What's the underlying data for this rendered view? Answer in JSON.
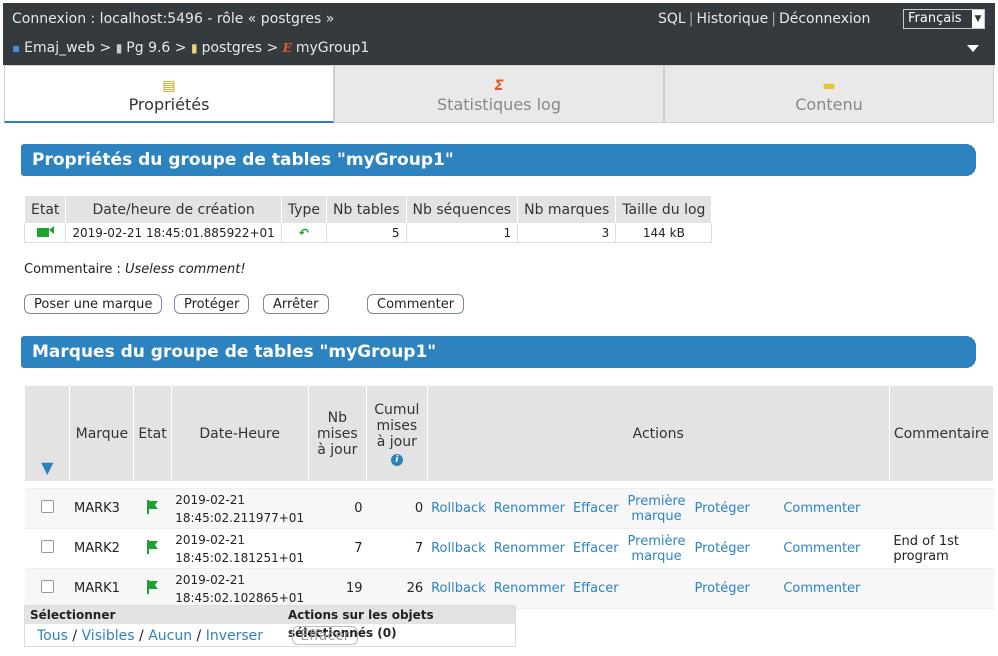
{
  "header": {
    "connexion": "Connexion : localhost:5496 - rôle « postgres »",
    "links": [
      "SQL",
      "Historique",
      "Déconnexion"
    ],
    "language": "Français"
  },
  "breadcrumb": [
    {
      "icon": "emaj-icon",
      "label": "Emaj_web"
    },
    {
      "icon": "server-icon",
      "label": "Pg 9.6"
    },
    {
      "icon": "database-icon",
      "label": "postgres"
    },
    {
      "icon": "group-icon",
      "label": "myGroup1"
    }
  ],
  "tabs": [
    {
      "label": "Propriétés",
      "icon": "properties-icon",
      "active": true
    },
    {
      "label": "Statistiques log",
      "icon": "sigma-icon",
      "active": false
    },
    {
      "label": "Contenu",
      "icon": "folder-icon",
      "active": false
    }
  ],
  "properties": {
    "title": "Propriétés du groupe de tables \"myGroup1\"",
    "headers": [
      "Etat",
      "Date/heure de création",
      "Type",
      "Nb tables",
      "Nb séquences",
      "Nb marques",
      "Taille du log"
    ],
    "row": {
      "created": "2019-02-21 18:45:01.885922+01",
      "nb_tables": "5",
      "nb_sequences": "1",
      "nb_marques": "3",
      "log_size": "144 kB"
    },
    "comment_label": "Commentaire : ",
    "comment_value": "Useless comment!",
    "buttons": [
      "Poser une marque",
      "Protéger",
      "Arrêter",
      "Commenter"
    ]
  },
  "marks": {
    "title": "Marques du groupe de tables \"myGroup1\"",
    "headers": {
      "marque": "Marque",
      "etat": "Etat",
      "date": "Date-Heure",
      "nb": "Nb mises à jour",
      "cumul": "Cumul mises à jour",
      "actions": "Actions",
      "commentaire": "Commentaire"
    },
    "rows": [
      {
        "mark": "MARK3",
        "date1": "2019-02-21",
        "date2": "18:45:02.211977+01",
        "nb": "0",
        "cumul": "0",
        "a1": "Rollback",
        "a2": "Renommer",
        "a3": "Effacer",
        "a4": "Première marque",
        "a5": "Protéger",
        "a6": "Commenter",
        "comment": ""
      },
      {
        "mark": "MARK2",
        "date1": "2019-02-21",
        "date2": "18:45:02.181251+01",
        "nb": "7",
        "cumul": "7",
        "a1": "Rollback",
        "a2": "Renommer",
        "a3": "Effacer",
        "a4": "Première marque",
        "a5": "Protéger",
        "a6": "Commenter",
        "comment": "End of 1st program"
      },
      {
        "mark": "MARK1",
        "date1": "2019-02-21",
        "date2": "18:45:02.102865+01",
        "nb": "19",
        "cumul": "26",
        "a1": "Rollback",
        "a2": "Renommer",
        "a3": "Effacer",
        "a4": "",
        "a5": "Protéger",
        "a6": "Commenter",
        "comment": ""
      }
    ]
  },
  "selection": {
    "label": "Sélectionner",
    "actions_label": "Actions sur les objets sélectionnés (0)",
    "links": [
      "Tous",
      "Visibles",
      "Aucun",
      "Inverser"
    ],
    "button": "Effacer"
  },
  "colors": {
    "accent": "#2d83c0",
    "topbar": "#353a3f",
    "flag": "#1aa32e"
  }
}
